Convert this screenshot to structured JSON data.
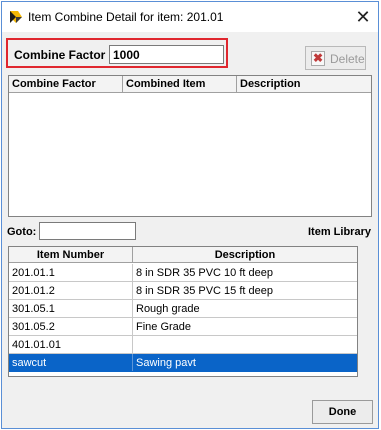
{
  "window": {
    "title": "Item Combine Detail for item: 201.01",
    "close_symbol": "✕"
  },
  "combine": {
    "label": "Combine Factor",
    "value": "1000"
  },
  "toolbar": {
    "delete_label": "Delete",
    "delete_icon_glyph": "✖"
  },
  "combined_grid": {
    "columns": [
      "Combine Factor",
      "Combined Item",
      "Description"
    ]
  },
  "goto": {
    "label": "Goto:",
    "value": ""
  },
  "library": {
    "label": "Item Library",
    "columns": [
      "Item Number",
      "Description"
    ],
    "rows": [
      {
        "item": "201.01.1",
        "description": "8 in SDR 35 PVC 10 ft deep"
      },
      {
        "item": "201.01.2",
        "description": "8 in SDR 35 PVC 15 ft deep"
      },
      {
        "item": "301.05.1",
        "description": "Rough grade"
      },
      {
        "item": "301.05.2",
        "description": "Fine Grade"
      },
      {
        "item": "401.01.01",
        "description": ""
      },
      {
        "item": "sawcut",
        "description": "Sawing pavt",
        "selected": true
      }
    ]
  },
  "footer": {
    "done_label": "Done"
  },
  "colors": {
    "highlight_border": "#e0272f",
    "selection": "#0a64c8",
    "window_border": "#5a8fd6"
  }
}
